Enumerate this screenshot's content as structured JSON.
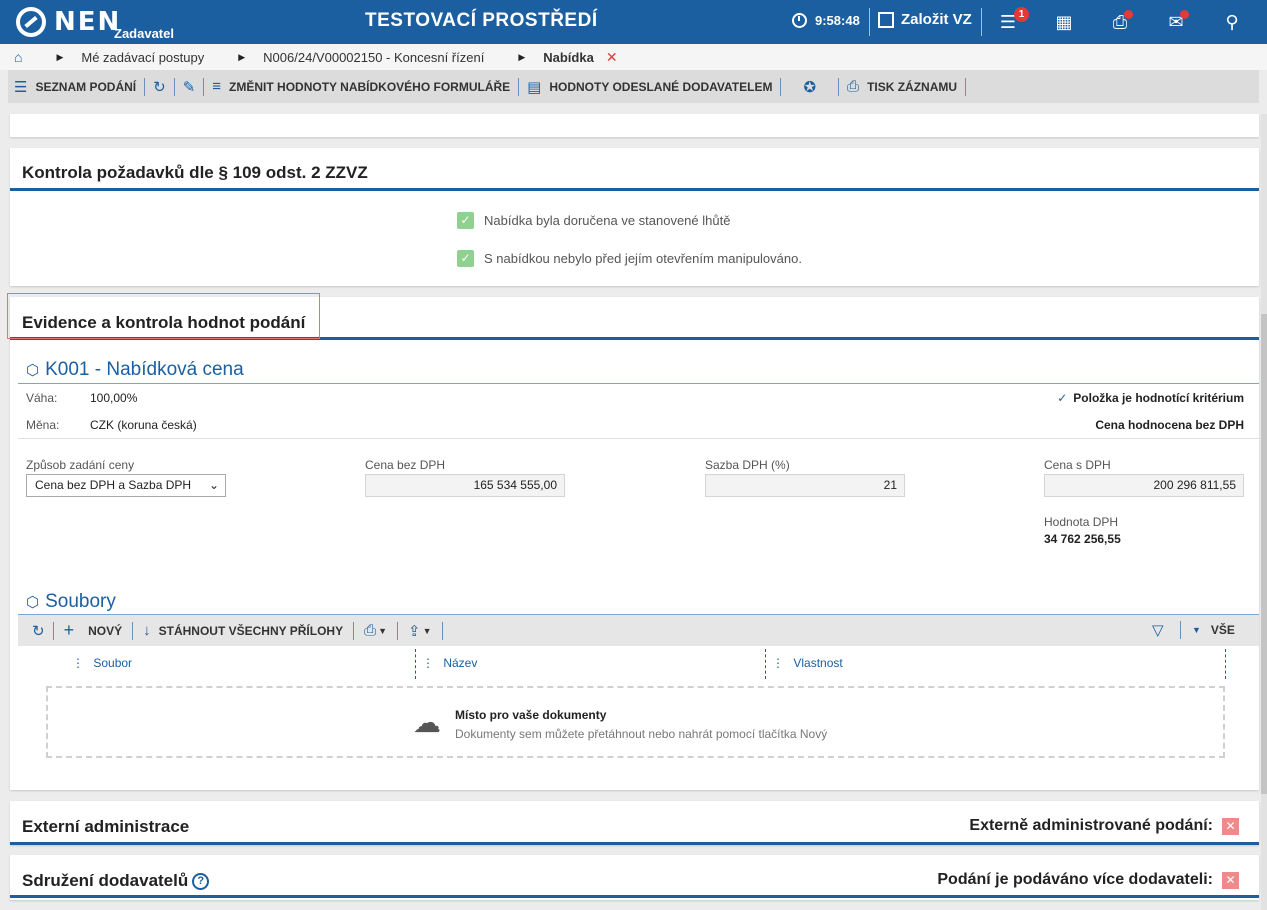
{
  "header": {
    "logo": "NEN",
    "logo_sub": "Zadavatel",
    "env_title": "TESTOVACÍ PROSTŘEDÍ",
    "time": "9:58:48",
    "new_vz": "Založit VZ",
    "menu_badge": "1"
  },
  "breadcrumb": {
    "items": [
      "Mé zadávací postupy",
      "N006/24/V00002150 - Koncesní řízení",
      "Nabídka"
    ]
  },
  "toolbar": {
    "list": "SEZNAM PODÁNÍ",
    "change": "ZMĚNIT HODNOTY NABÍDKOVÉHO FORMULÁŘE",
    "sent": "HODNOTY ODESLANÉ DODAVATELEM",
    "print": "TISK ZÁZNAMU"
  },
  "check_panel": {
    "title": "Kontrola požadavků dle § 109 odst. 2 ZZVZ",
    "item1": "Nabídka byla doručena ve stanovené lhůtě",
    "item2": "S nabídkou nebylo před jejím otevřením manipulováno."
  },
  "evidence": {
    "title": "Evidence a kontrola hodnot podání",
    "criterion": "K001 - Nabídková cena",
    "weight_label": "Váha:",
    "weight": "100,00%",
    "currency_label": "Měna:",
    "currency": "CZK (koruna česká)",
    "is_criterion": "Položka je hodnotící kritérium",
    "evaluated": "Cena hodnocena bez DPH",
    "price_mode_label": "Způsob zadání ceny",
    "price_mode": "Cena bez DPH a Sazba DPH",
    "net_label": "Cena bez DPH",
    "net": "165 534 555,00",
    "vat_rate_label": "Sazba DPH (%)",
    "vat_rate": "21",
    "gross_label": "Cena s DPH",
    "gross": "200 296 811,55",
    "vat_value_label": "Hodnota DPH",
    "vat_value": "34 762 256,55"
  },
  "files": {
    "title": "Soubory",
    "new": "NOVÝ",
    "download": "STÁHNOUT VŠECHNY PŘÍLOHY",
    "all": "VŠE",
    "col_file": "Soubor",
    "col_name": "Název",
    "col_props": "Vlastnost",
    "drop_title": "Místo pro vaše dokumenty",
    "drop_hint": "Dokumenty sem můžete přetáhnout nebo nahrát pomocí tlačítka Nový"
  },
  "external": {
    "title": "Externí administrace",
    "label": "Externě administrované podání:"
  },
  "association": {
    "title": "Sdružení dodavatelů",
    "label": "Podání je podáváno více dodavateli:"
  }
}
